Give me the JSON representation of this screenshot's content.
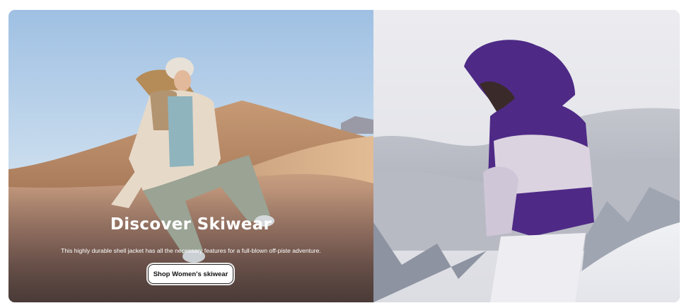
{
  "hero": {
    "headline": "Discover Skiwear",
    "description": "This highly durable shell jacket has all the necessary features for a full-blown off-piste adventure.",
    "cta_label": "Shop Women's skiwear"
  },
  "images": {
    "left": "woman-sitting-on-sand-dune-photo",
    "right": "woman-in-purple-puffer-jacket-snow-photo"
  },
  "colors": {
    "cta_background": "#ffffff",
    "cta_text": "#111111",
    "headline_text": "#ffffff",
    "jacket_purple": "#4e2a86"
  }
}
